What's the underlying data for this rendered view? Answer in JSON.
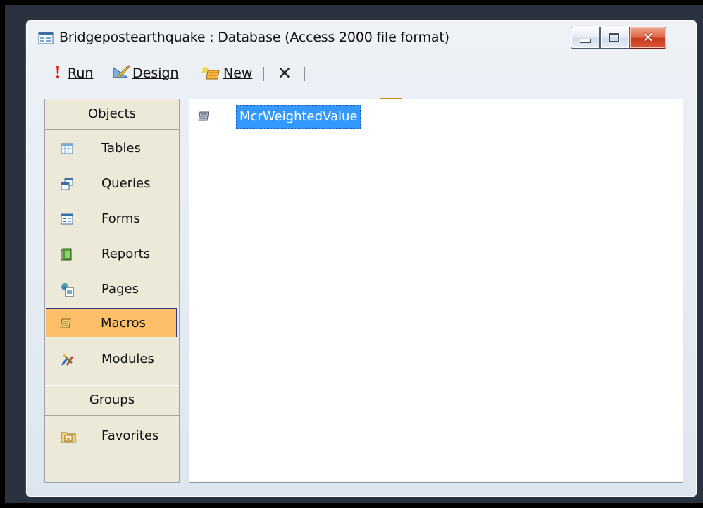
{
  "window": {
    "title": "Bridgepostearthquake : Database (Access 2000 file format)",
    "minimize_icon": "minimize-icon",
    "maximize_icon": "maximize-icon",
    "close_symbol": "✕"
  },
  "toolbar": {
    "run_label": "Run",
    "design_label": "Design",
    "new_label": "New",
    "delete_symbol": "✕",
    "view_icons": [
      "large-icons-icon",
      "small-icons-icon",
      "list-view-icon",
      "details-view-icon"
    ],
    "active_view": "list-view-icon"
  },
  "sidebar": {
    "objects_header": "Objects",
    "items": [
      {
        "label": "Tables",
        "icon": "table-icon"
      },
      {
        "label": "Queries",
        "icon": "query-icon"
      },
      {
        "label": "Forms",
        "icon": "form-icon"
      },
      {
        "label": "Reports",
        "icon": "report-icon"
      },
      {
        "label": "Pages",
        "icon": "page-icon"
      },
      {
        "label": "Macros",
        "icon": "macro-icon",
        "selected": true
      },
      {
        "label": "Modules",
        "icon": "module-icon"
      }
    ],
    "groups_header": "Groups",
    "groups": [
      {
        "label": "Favorites",
        "icon": "favorites-folder-icon"
      }
    ]
  },
  "object_list": {
    "items": [
      {
        "label": "McrWeightedValue",
        "icon": "macro-icon",
        "selected": true
      }
    ]
  },
  "colors": {
    "selection_highlight": "#fdbf68",
    "list_selection": "#3399ff",
    "panel_background": "#ece9d8",
    "close_button": "#d9593a"
  }
}
